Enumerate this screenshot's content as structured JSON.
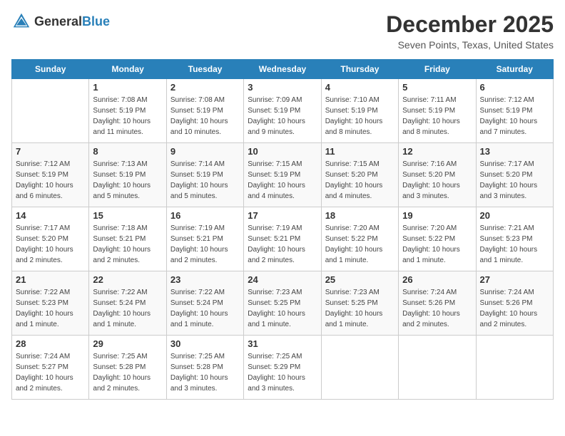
{
  "header": {
    "logo": {
      "text_general": "General",
      "text_blue": "Blue"
    },
    "title": "December 2025",
    "location": "Seven Points, Texas, United States"
  },
  "weekdays": [
    "Sunday",
    "Monday",
    "Tuesday",
    "Wednesday",
    "Thursday",
    "Friday",
    "Saturday"
  ],
  "weeks": [
    [
      {
        "day": "",
        "sunrise": "",
        "sunset": "",
        "daylight": ""
      },
      {
        "day": "1",
        "sunrise": "Sunrise: 7:08 AM",
        "sunset": "Sunset: 5:19 PM",
        "daylight": "Daylight: 10 hours and 11 minutes."
      },
      {
        "day": "2",
        "sunrise": "Sunrise: 7:08 AM",
        "sunset": "Sunset: 5:19 PM",
        "daylight": "Daylight: 10 hours and 10 minutes."
      },
      {
        "day": "3",
        "sunrise": "Sunrise: 7:09 AM",
        "sunset": "Sunset: 5:19 PM",
        "daylight": "Daylight: 10 hours and 9 minutes."
      },
      {
        "day": "4",
        "sunrise": "Sunrise: 7:10 AM",
        "sunset": "Sunset: 5:19 PM",
        "daylight": "Daylight: 10 hours and 8 minutes."
      },
      {
        "day": "5",
        "sunrise": "Sunrise: 7:11 AM",
        "sunset": "Sunset: 5:19 PM",
        "daylight": "Daylight: 10 hours and 8 minutes."
      },
      {
        "day": "6",
        "sunrise": "Sunrise: 7:12 AM",
        "sunset": "Sunset: 5:19 PM",
        "daylight": "Daylight: 10 hours and 7 minutes."
      }
    ],
    [
      {
        "day": "7",
        "sunrise": "Sunrise: 7:12 AM",
        "sunset": "Sunset: 5:19 PM",
        "daylight": "Daylight: 10 hours and 6 minutes."
      },
      {
        "day": "8",
        "sunrise": "Sunrise: 7:13 AM",
        "sunset": "Sunset: 5:19 PM",
        "daylight": "Daylight: 10 hours and 5 minutes."
      },
      {
        "day": "9",
        "sunrise": "Sunrise: 7:14 AM",
        "sunset": "Sunset: 5:19 PM",
        "daylight": "Daylight: 10 hours and 5 minutes."
      },
      {
        "day": "10",
        "sunrise": "Sunrise: 7:15 AM",
        "sunset": "Sunset: 5:19 PM",
        "daylight": "Daylight: 10 hours and 4 minutes."
      },
      {
        "day": "11",
        "sunrise": "Sunrise: 7:15 AM",
        "sunset": "Sunset: 5:20 PM",
        "daylight": "Daylight: 10 hours and 4 minutes."
      },
      {
        "day": "12",
        "sunrise": "Sunrise: 7:16 AM",
        "sunset": "Sunset: 5:20 PM",
        "daylight": "Daylight: 10 hours and 3 minutes."
      },
      {
        "day": "13",
        "sunrise": "Sunrise: 7:17 AM",
        "sunset": "Sunset: 5:20 PM",
        "daylight": "Daylight: 10 hours and 3 minutes."
      }
    ],
    [
      {
        "day": "14",
        "sunrise": "Sunrise: 7:17 AM",
        "sunset": "Sunset: 5:20 PM",
        "daylight": "Daylight: 10 hours and 2 minutes."
      },
      {
        "day": "15",
        "sunrise": "Sunrise: 7:18 AM",
        "sunset": "Sunset: 5:21 PM",
        "daylight": "Daylight: 10 hours and 2 minutes."
      },
      {
        "day": "16",
        "sunrise": "Sunrise: 7:19 AM",
        "sunset": "Sunset: 5:21 PM",
        "daylight": "Daylight: 10 hours and 2 minutes."
      },
      {
        "day": "17",
        "sunrise": "Sunrise: 7:19 AM",
        "sunset": "Sunset: 5:21 PM",
        "daylight": "Daylight: 10 hours and 2 minutes."
      },
      {
        "day": "18",
        "sunrise": "Sunrise: 7:20 AM",
        "sunset": "Sunset: 5:22 PM",
        "daylight": "Daylight: 10 hours and 1 minute."
      },
      {
        "day": "19",
        "sunrise": "Sunrise: 7:20 AM",
        "sunset": "Sunset: 5:22 PM",
        "daylight": "Daylight: 10 hours and 1 minute."
      },
      {
        "day": "20",
        "sunrise": "Sunrise: 7:21 AM",
        "sunset": "Sunset: 5:23 PM",
        "daylight": "Daylight: 10 hours and 1 minute."
      }
    ],
    [
      {
        "day": "21",
        "sunrise": "Sunrise: 7:22 AM",
        "sunset": "Sunset: 5:23 PM",
        "daylight": "Daylight: 10 hours and 1 minute."
      },
      {
        "day": "22",
        "sunrise": "Sunrise: 7:22 AM",
        "sunset": "Sunset: 5:24 PM",
        "daylight": "Daylight: 10 hours and 1 minute."
      },
      {
        "day": "23",
        "sunrise": "Sunrise: 7:22 AM",
        "sunset": "Sunset: 5:24 PM",
        "daylight": "Daylight: 10 hours and 1 minute."
      },
      {
        "day": "24",
        "sunrise": "Sunrise: 7:23 AM",
        "sunset": "Sunset: 5:25 PM",
        "daylight": "Daylight: 10 hours and 1 minute."
      },
      {
        "day": "25",
        "sunrise": "Sunrise: 7:23 AM",
        "sunset": "Sunset: 5:25 PM",
        "daylight": "Daylight: 10 hours and 1 minute."
      },
      {
        "day": "26",
        "sunrise": "Sunrise: 7:24 AM",
        "sunset": "Sunset: 5:26 PM",
        "daylight": "Daylight: 10 hours and 2 minutes."
      },
      {
        "day": "27",
        "sunrise": "Sunrise: 7:24 AM",
        "sunset": "Sunset: 5:26 PM",
        "daylight": "Daylight: 10 hours and 2 minutes."
      }
    ],
    [
      {
        "day": "28",
        "sunrise": "Sunrise: 7:24 AM",
        "sunset": "Sunset: 5:27 PM",
        "daylight": "Daylight: 10 hours and 2 minutes."
      },
      {
        "day": "29",
        "sunrise": "Sunrise: 7:25 AM",
        "sunset": "Sunset: 5:28 PM",
        "daylight": "Daylight: 10 hours and 2 minutes."
      },
      {
        "day": "30",
        "sunrise": "Sunrise: 7:25 AM",
        "sunset": "Sunset: 5:28 PM",
        "daylight": "Daylight: 10 hours and 3 minutes."
      },
      {
        "day": "31",
        "sunrise": "Sunrise: 7:25 AM",
        "sunset": "Sunset: 5:29 PM",
        "daylight": "Daylight: 10 hours and 3 minutes."
      },
      {
        "day": "",
        "sunrise": "",
        "sunset": "",
        "daylight": ""
      },
      {
        "day": "",
        "sunrise": "",
        "sunset": "",
        "daylight": ""
      },
      {
        "day": "",
        "sunrise": "",
        "sunset": "",
        "daylight": ""
      }
    ]
  ]
}
